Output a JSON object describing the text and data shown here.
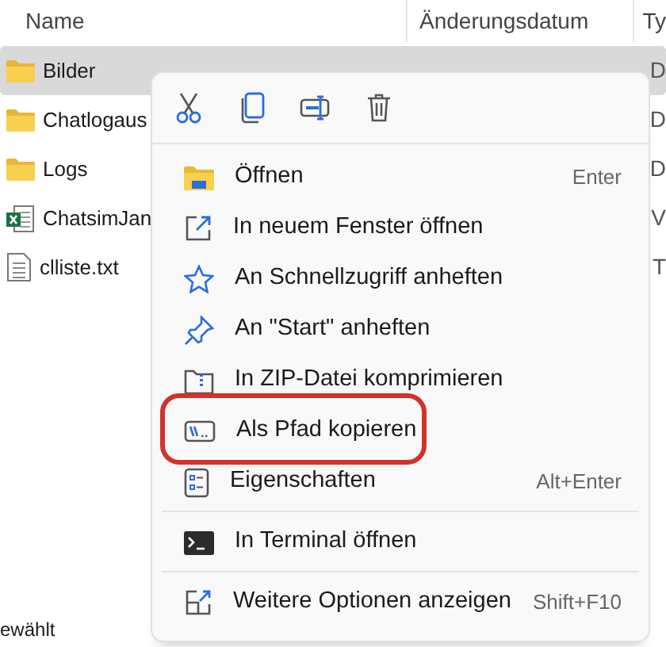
{
  "columns": [
    {
      "label": "Name"
    },
    {
      "label": "Änderungsdatum"
    },
    {
      "label": "Ty"
    }
  ],
  "files": [
    {
      "name": "Bilder",
      "kind": "folder",
      "type": "D",
      "selected": true
    },
    {
      "name": "Chatlogaus",
      "kind": "folder",
      "type": "D",
      "selected": false
    },
    {
      "name": "Logs",
      "kind": "folder",
      "type": "D",
      "selected": false
    },
    {
      "name": "ChatsimJan",
      "kind": "excel",
      "type": "V",
      "selected": false
    },
    {
      "name": "clliste.txt",
      "kind": "text",
      "type": "T",
      "selected": false
    }
  ],
  "status_bar": "ewählt",
  "context_menu": {
    "quick_actions": [
      {
        "kind": "cut"
      },
      {
        "kind": "copy"
      },
      {
        "kind": "rename"
      },
      {
        "kind": "delete"
      }
    ],
    "entries": [
      {
        "kind": "item",
        "label": "Öffnen",
        "shortcut": "Enter",
        "highlighted": false
      },
      {
        "kind": "item",
        "label": "In neuem Fenster öffnen",
        "highlighted": false
      },
      {
        "kind": "item",
        "label": "An Schnellzugriff anheften",
        "highlighted": false
      },
      {
        "kind": "item",
        "label": "An \"Start\" anheften",
        "highlighted": false
      },
      {
        "kind": "item",
        "label": "In ZIP-Datei komprimieren",
        "highlighted": false
      },
      {
        "kind": "item",
        "label": "Als Pfad kopieren",
        "highlighted": true
      },
      {
        "kind": "item",
        "label": "Eigenschaften",
        "shortcut": "Alt+Enter",
        "highlighted": false
      },
      {
        "kind": "divider"
      },
      {
        "kind": "item",
        "label": "In Terminal öffnen",
        "highlighted": false
      },
      {
        "kind": "divider"
      },
      {
        "kind": "item",
        "label": "Weitere Optionen anzeigen",
        "shortcut": "Shift+F10",
        "highlighted": false
      }
    ]
  }
}
